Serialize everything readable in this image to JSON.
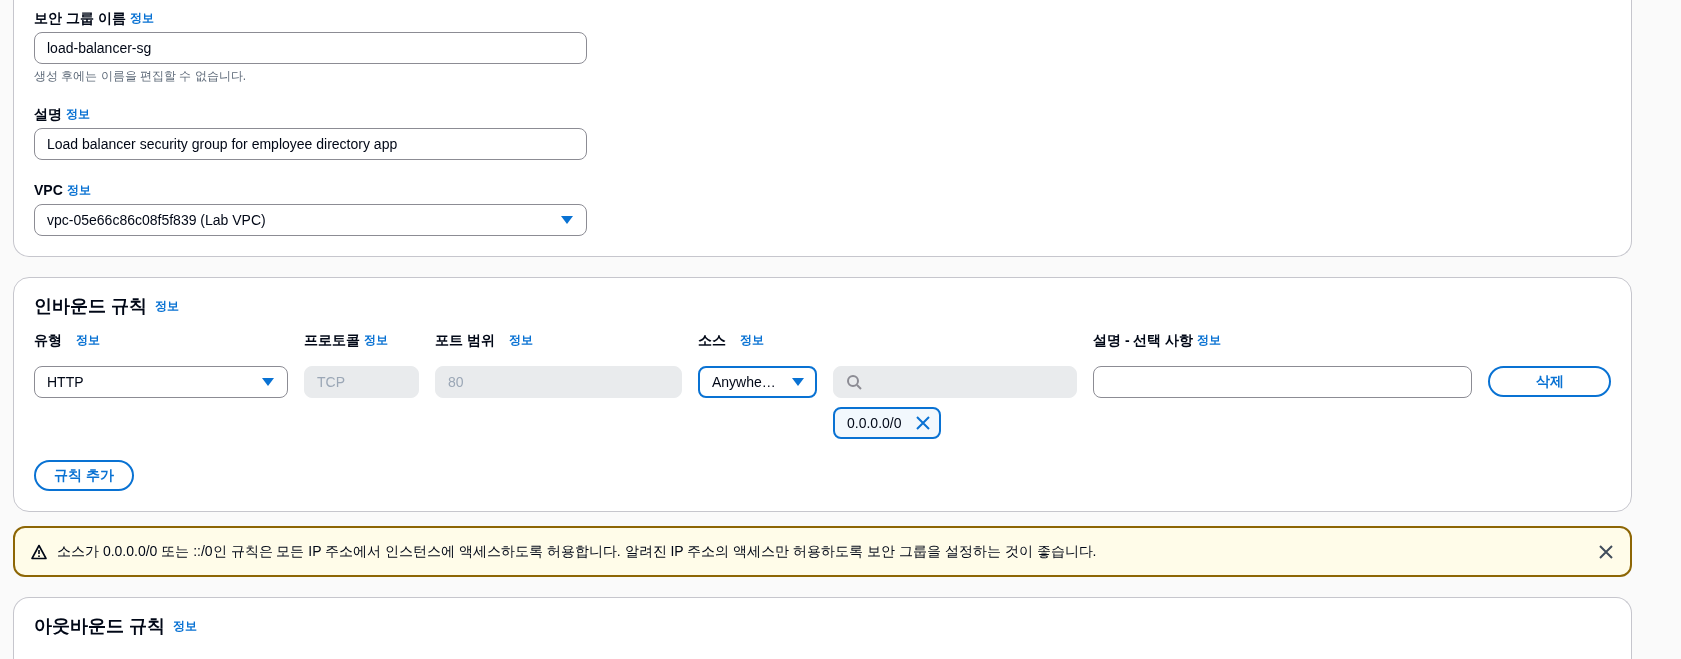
{
  "details": {
    "fields": [
      {
        "kind": "text",
        "label": "보안 그룹 이름",
        "info": "정보",
        "value": "load-balancer-sg",
        "hint": "생성 후에는 이름을 편집할 수 없습니다."
      },
      {
        "kind": "text",
        "label": "설명",
        "info": "정보",
        "value": "Load balancer security group for employee directory app"
      },
      {
        "kind": "select",
        "label": "VPC",
        "info": "정보",
        "value": "vpc-05e66c86c08f5f839 (Lab VPC)"
      }
    ]
  },
  "inbound_rules": {
    "title": "인바운드 규칙",
    "info": "정보",
    "columns": [
      {
        "label": "유형",
        "info": "정보"
      },
      {
        "label": "프로토콜",
        "info": "정보"
      },
      {
        "label": "포트 범위",
        "info": "정보"
      },
      {
        "label": "소스",
        "info": "정보"
      },
      {
        "label": "설명 - 선택 사항",
        "info": "정보"
      }
    ],
    "rows": [
      {
        "type": "HTTP",
        "protocol": {
          "value": "TCP",
          "disabled": true
        },
        "port_range": {
          "value": "80",
          "disabled": true
        },
        "source": "Anywhe…",
        "source_tokens": [
          "0.0.0.0/0"
        ],
        "delete_button": "삭제"
      }
    ],
    "add_button": "규칙 추가"
  },
  "alert": {
    "kind": "warning",
    "message": "소스가 0.0.0.0/0 또는 ::/0인 규칙은 모든 IP 주소에서 인스턴스에 액세스하도록 허용합니다. 알려진 IP 주소의 액세스만 허용하도록 보안 그룹을 설정하는 것이 좋습니다."
  },
  "outbound_rules": {
    "title": "아웃바운드 규칙",
    "info": "정보"
  }
}
